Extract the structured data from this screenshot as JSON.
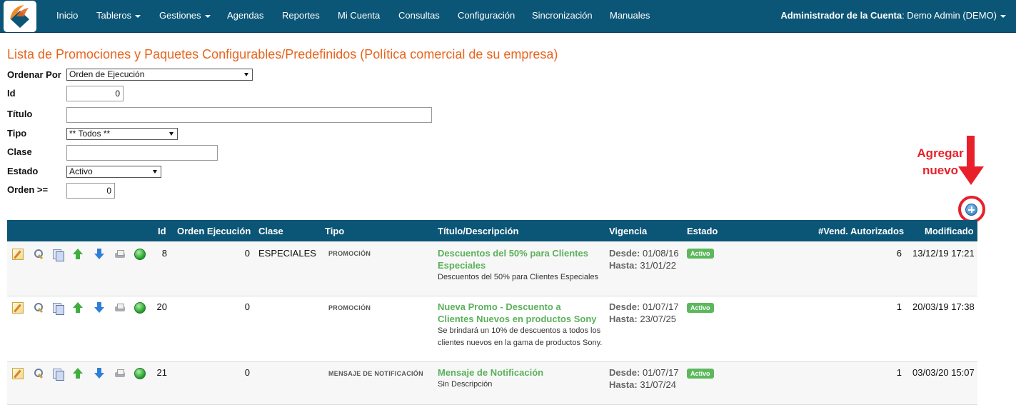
{
  "nav": {
    "items": [
      {
        "label": "Inicio",
        "dropdown": false
      },
      {
        "label": "Tableros",
        "dropdown": true
      },
      {
        "label": "Gestiones",
        "dropdown": true
      },
      {
        "label": "Agendas",
        "dropdown": false
      },
      {
        "label": "Reportes",
        "dropdown": false
      },
      {
        "label": "Mi Cuenta",
        "dropdown": false
      },
      {
        "label": "Consultas",
        "dropdown": false
      },
      {
        "label": "Configuración",
        "dropdown": false
      },
      {
        "label": "Sincronización",
        "dropdown": false
      },
      {
        "label": "Manuales",
        "dropdown": false
      }
    ],
    "user_role": "Administrador de la Cuenta",
    "user_name": ": Demo Admin (DEMO)"
  },
  "page": {
    "title": "Lista de Promociones y Paquetes Configurables/Predefinidos (Política comercial de su empresa)"
  },
  "filters": {
    "ordenar_por": {
      "label": "Ordenar Por",
      "value": "Orden de Ejecución"
    },
    "id": {
      "label": "Id",
      "value": "0"
    },
    "titulo": {
      "label": "Título",
      "value": ""
    },
    "tipo": {
      "label": "Tipo",
      "value": "** Todos **"
    },
    "clase": {
      "label": "Clase",
      "value": ""
    },
    "estado": {
      "label": "Estado",
      "value": "Activo"
    },
    "orden": {
      "label": "Orden >=",
      "value": "0"
    }
  },
  "annotation": {
    "line1": "Agregar",
    "line2": "nuevo"
  },
  "table": {
    "headers": {
      "id": "Id",
      "orden": "Orden Ejecución",
      "clase": "Clase",
      "tipo": "Tipo",
      "titulo": "Título/Descripción",
      "vigencia": "Vigencia",
      "estado": "Estado",
      "vend": "#Vend. Autorizados",
      "modificado": "Modificado"
    },
    "rows": [
      {
        "id": "8",
        "orden": "0",
        "clase": "ESPECIALES",
        "tipo": "PROMOCIÓN",
        "titulo": "Descuentos del 50% para Clientes Especiales",
        "descripcion": "Descuentos del 50% para Clientes Especiales",
        "desde_label": "Desde:",
        "desde": " 01/08/16",
        "hasta_label": "Hasta:",
        "hasta": " 31/01/22",
        "estado": "Activo",
        "vend": "6",
        "modificado": "13/12/19 17:21"
      },
      {
        "id": "20",
        "orden": "0",
        "clase": "",
        "tipo": "PROMOCIÓN",
        "titulo": "Nueva Promo - Descuento a Clientes Nuevos en productos Sony",
        "descripcion": "Se brindará un 10% de descuentos a todos los clientes nuevos en la gama de productos Sony.",
        "desde_label": "Desde:",
        "desde": " 01/07/17",
        "hasta_label": "Hasta:",
        "hasta": " 23/07/25",
        "estado": "Activo",
        "vend": "1",
        "modificado": "20/03/19 17:38"
      },
      {
        "id": "21",
        "orden": "0",
        "clase": "",
        "tipo": "MENSAJE DE NOTIFICACIÓN",
        "titulo": "Mensaje de Notificación",
        "descripcion": "Sin Descripción",
        "desde_label": "Desde:",
        "desde": " 01/07/17",
        "hasta_label": "Hasta:",
        "hasta": " 31/07/24",
        "estado": "Activo",
        "vend": "1",
        "modificado": "03/03/20 15:07"
      }
    ]
  },
  "colors": {
    "navbar": "#0b5576",
    "title": "#e8641e",
    "accent_green": "#5cb85c",
    "annotation_red": "#e8202a"
  },
  "icons": [
    "edit-icon",
    "view-icon",
    "copy-icon",
    "move-up-icon",
    "move-down-icon",
    "print-icon",
    "status-icon",
    "add-new-icon"
  ]
}
